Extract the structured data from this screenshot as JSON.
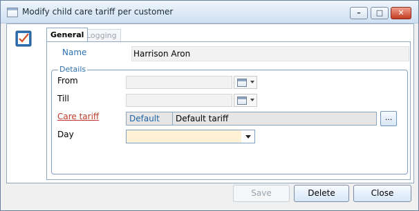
{
  "window": {
    "title": "Modify child care tariff per customer",
    "controls": {
      "minimize_icon": "minimize-icon",
      "maximize_icon": "maximize-icon",
      "close_icon": "close-icon"
    }
  },
  "tabs": [
    {
      "label": "General",
      "active": true
    },
    {
      "label": "Logging",
      "active": false
    }
  ],
  "form": {
    "name_label": "Name",
    "name_value": "Harrison Aron",
    "details_title": "Details",
    "from_label": "From",
    "till_label": "Till",
    "care_tariff_label": "Care tariff",
    "care_tariff_code": "Default",
    "care_tariff_name": "Default tariff",
    "care_tariff_lookup": "...",
    "day_label": "Day",
    "day_value": ""
  },
  "buttons": {
    "save": "Save",
    "delete": "Delete",
    "close": "Close"
  },
  "colors": {
    "accent": "#2b70b0",
    "required_label": "#c0392b",
    "day_highlight": "#fdf2d5"
  }
}
